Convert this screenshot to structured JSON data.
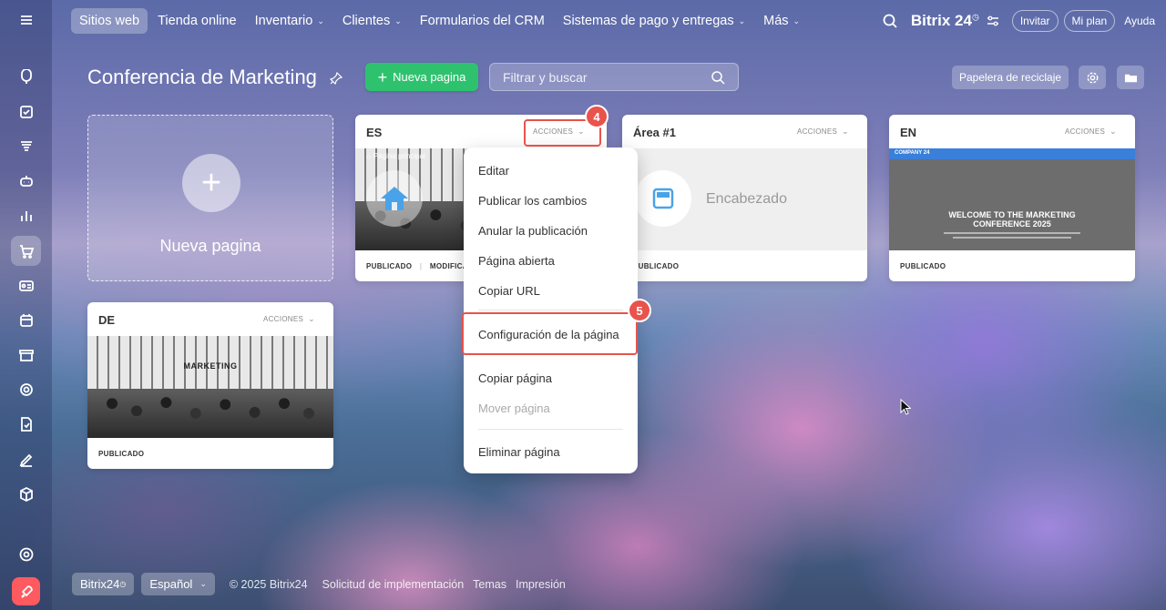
{
  "nav": {
    "items": [
      {
        "label": "Sitios web",
        "dropdown": false
      },
      {
        "label": "Tienda online",
        "dropdown": false
      },
      {
        "label": "Inventario",
        "dropdown": true
      },
      {
        "label": "Clientes",
        "dropdown": true
      },
      {
        "label": "Formularios del CRM",
        "dropdown": false
      },
      {
        "label": "Sistemas de pago y entregas",
        "dropdown": true
      },
      {
        "label": "Más",
        "dropdown": true
      }
    ],
    "brand": "Bitrix 24",
    "invite": "Invitar",
    "plan": "Mi plan",
    "help": "Ayuda"
  },
  "page": {
    "title": "Conferencia de Marketing",
    "new_button": "Nueva pagina",
    "filter_placeholder": "Filtrar y buscar",
    "trash_button": "Papelera de reciclaje"
  },
  "new_card_label": "Nueva pagina",
  "cards": {
    "es": {
      "title": "ES",
      "actions": "ACCIONES",
      "status": "PUBLICADO",
      "modified": "MODIFICADO",
      "home_label": "Página principal"
    },
    "area": {
      "title": "Área #1",
      "actions": "ACCIONES",
      "block": "Encabezado",
      "status": "PUBLICADO"
    },
    "en": {
      "title": "EN",
      "actions": "ACCIONES",
      "status": "PUBLICADO",
      "thumb_company": "COMPANY 24",
      "thumb_heading_1": "WELCOME TO THE MARKETING",
      "thumb_heading_2": "CONFERENCE 2025"
    },
    "de": {
      "title": "DE",
      "actions": "ACCIONES",
      "status": "PUBLICADO",
      "sign": "MARKETING"
    }
  },
  "menu": {
    "items": [
      {
        "label": "Editar"
      },
      {
        "label": "Publicar los cambios"
      },
      {
        "label": "Anular la publicación"
      },
      {
        "label": "Página abierta"
      },
      {
        "label": "Copiar URL"
      },
      {
        "label": "Configuración de la página"
      },
      {
        "label": "Copiar página"
      },
      {
        "label": "Mover página"
      },
      {
        "label": "Eliminar página"
      }
    ]
  },
  "callouts": {
    "step4": "4",
    "step5": "5"
  },
  "footer": {
    "brand": "Bitrix24",
    "language": "Español",
    "copyright": "© 2025 Bitrix24",
    "links": [
      "Solicitud de implementación",
      "Temas",
      "Impresión"
    ]
  },
  "colors": {
    "accent_green": "#2fc26e",
    "callout_red": "#e8534b"
  }
}
